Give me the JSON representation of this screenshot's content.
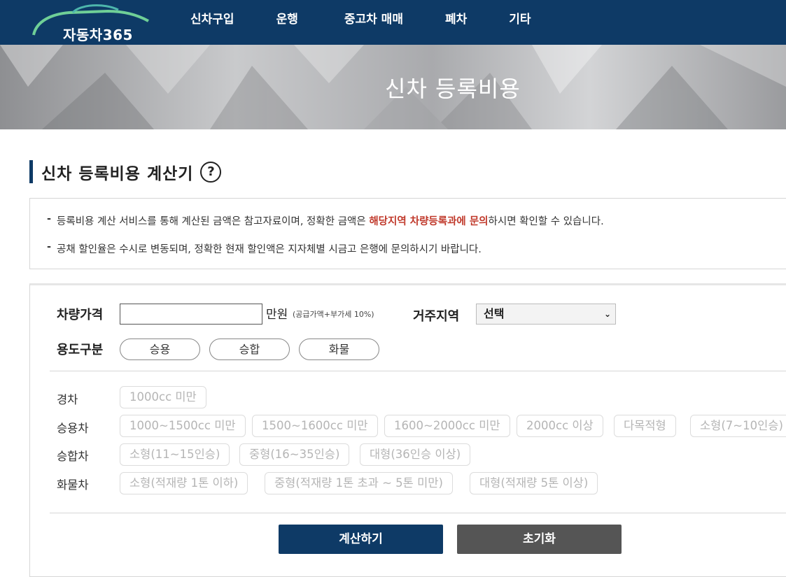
{
  "header": {
    "logo_text": "자동차365",
    "nav": [
      "신차구입",
      "운행",
      "중고차 매매",
      "폐차",
      "기타"
    ]
  },
  "hero": {
    "title": "신차 등록비용"
  },
  "section": {
    "title": "신차 등록비용 계산기",
    "help_icon": "question-circle-icon"
  },
  "notice": {
    "line1_before": "등록비용 계산 서비스를 통해 계산된 금액은 참고자료이며, 정확한 금액은 ",
    "line1_highlight": "해당지역 차량등록과에 문의",
    "line1_after": "하시면 확인할 수 있습니다.",
    "line2": "공채 할인율은 수시로 변동되며, 정확한 현재 할인액은 지자체별 시금고 은행에 문의하시기 바랍니다."
  },
  "form": {
    "price_label": "차량가격",
    "price_value": "",
    "price_unit": "만원",
    "price_note": "(공급가액+부가세 10%)",
    "region_label": "거주지역",
    "region_selected": "선택",
    "usage_label": "용도구분",
    "usage_options": [
      "승용",
      "승합",
      "화물"
    ],
    "vehicle_groups": [
      {
        "label": "경차",
        "options": [
          "1000cc 미만"
        ]
      },
      {
        "label": "승용차",
        "options": [
          "1000~1500cc 미만",
          "1500~1600cc 미만",
          "1600~2000cc 미만",
          "2000cc 이상",
          "다목적형",
          "소형(7~10인승)"
        ]
      },
      {
        "label": "승합차",
        "options": [
          "소형(11~15인승)",
          "중형(16~35인승)",
          "대형(36인승 이상)"
        ]
      },
      {
        "label": "화물차",
        "options": [
          "소형(적재량 1톤 이하)",
          "중형(적재량 1톤 초과 ~ 5톤 미만)",
          "대형(적재량 5톤 이상)"
        ]
      }
    ],
    "calc_button": "계산하기",
    "reset_button": "초기화"
  },
  "colors": {
    "brand": "#0e3a66",
    "highlight": "#c0392b",
    "reset": "#555555"
  }
}
